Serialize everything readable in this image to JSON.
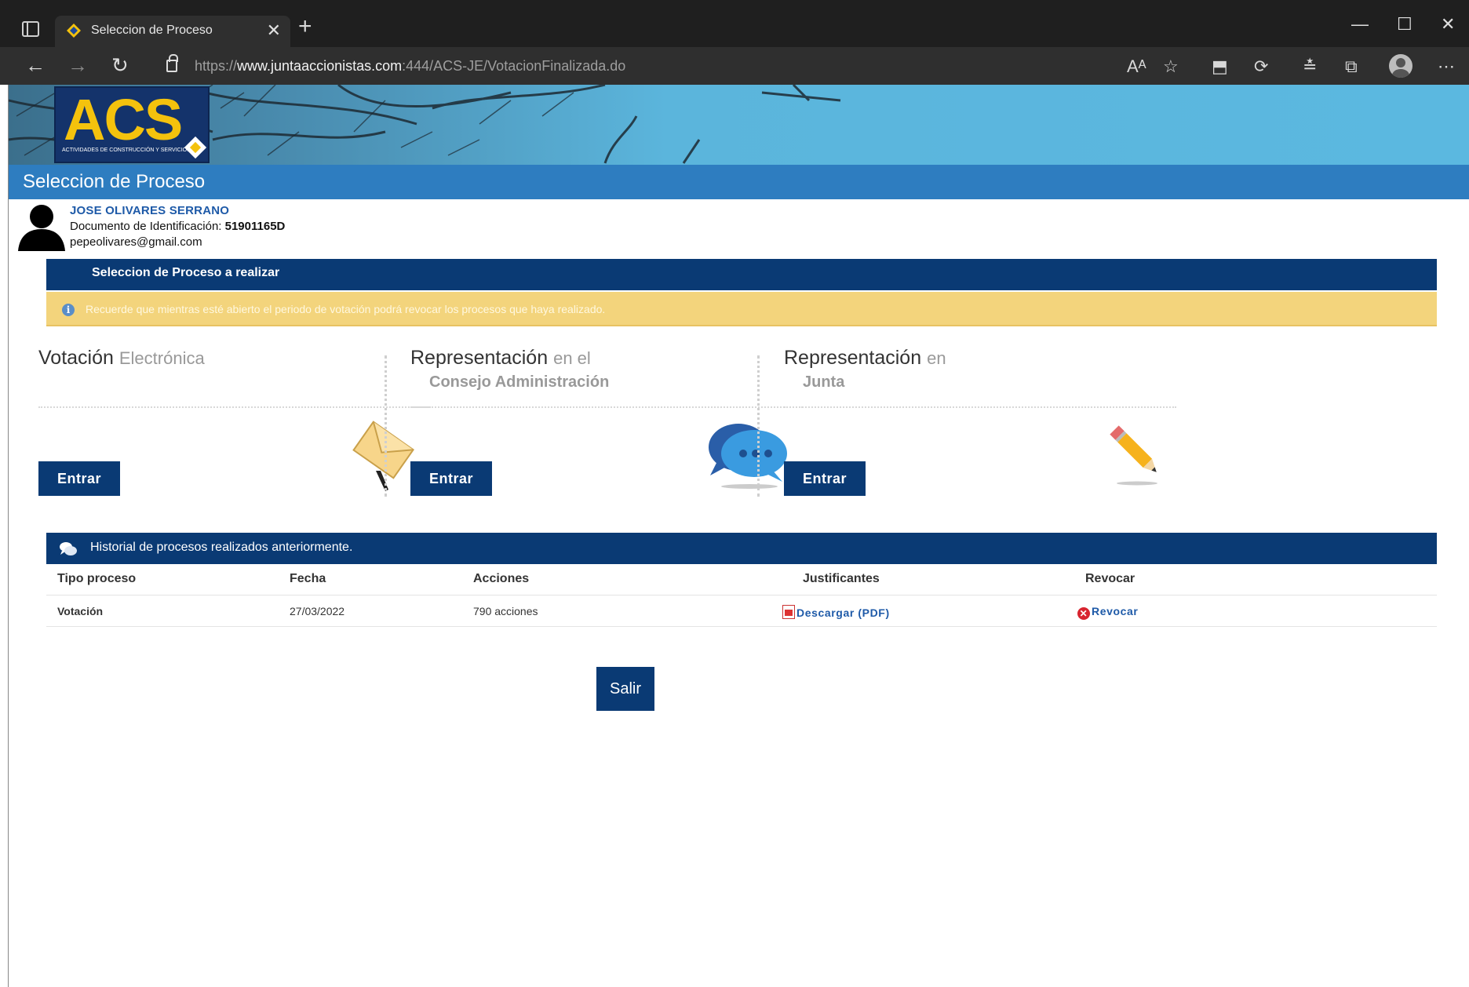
{
  "browser": {
    "tab_title": "Seleccion de Proceso",
    "tab_close": "✕",
    "new_tab": "+",
    "url_scheme": "https://",
    "url_domain": "www.juntaaccionistas.com",
    "url_path": ":444/ACS-JE/VotacionFinalizada.do",
    "window_controls": {
      "minimize": "—",
      "maximize": "☐",
      "close": "✕"
    },
    "nav": {
      "back": "←",
      "forward": "→",
      "refresh": "↻"
    },
    "tools": [
      "Aᴬ",
      "☆",
      "⬒",
      "⟳",
      "≛",
      "⧉",
      "⋯"
    ]
  },
  "banner": {
    "logo_text": "ACS",
    "logo_subtitle": "ACTIVIDADES DE CONSTRUCCIÓN Y SERVICIOS"
  },
  "page_title": "Seleccion de Proceso",
  "user": {
    "name": "JOSE OLIVARES SERRANO",
    "doc_label": "Documento de Identificación:",
    "doc_value": "51901165D",
    "email": "pepeolivares@gmail.com"
  },
  "section": {
    "title": "Seleccion de Proceso a realizar",
    "notice": "Recuerde que mientras esté abierto el periodo de votación podrá revocar los procesos que haya realizado."
  },
  "cards": [
    {
      "title_main": "Votación",
      "title_light": "Electrónica",
      "subtitle": "",
      "button": "Entrar",
      "icon": "envelope-icon"
    },
    {
      "title_main": "Representación",
      "title_light": "en el",
      "subtitle": "Consejo Administración",
      "button": "Entrar",
      "icon": "chat-bubbles-icon"
    },
    {
      "title_main": "Representación",
      "title_light": "en",
      "subtitle": "Junta",
      "button": "Entrar",
      "icon": "pencil-icon"
    }
  ],
  "history": {
    "title": "Historial de procesos realizados anteriormente.",
    "columns": [
      "Tipo proceso",
      "Fecha",
      "Acciones",
      "Justificantes",
      "Revocar"
    ],
    "rows": [
      {
        "tipo": "Votación",
        "fecha": "27/03/2022",
        "acciones": "790 acciones",
        "justificante": "Descargar (PDF)",
        "revocar": "Revocar"
      }
    ]
  },
  "exit_button": "Salir",
  "colors": {
    "navy": "#0a3a74",
    "title_blue": "#2e7dc0",
    "notice_yellow": "#f3d47c",
    "link_blue": "#1e5aa8",
    "logo_yellow": "#f4c20d"
  }
}
